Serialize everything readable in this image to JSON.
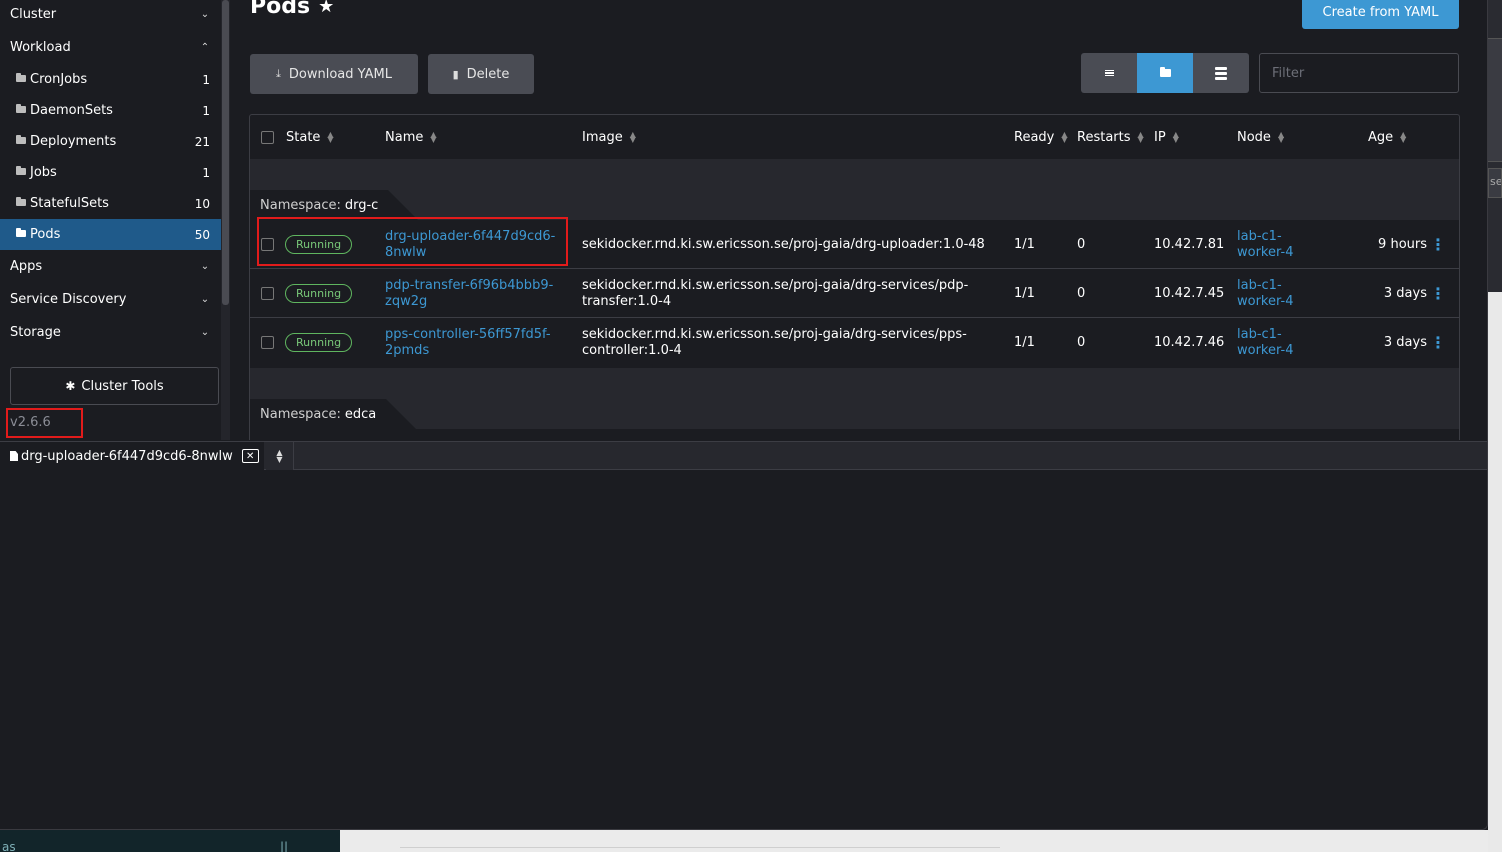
{
  "sidebar": {
    "groups": [
      {
        "label": "Cluster",
        "expanded": false
      },
      {
        "label": "Workload",
        "expanded": true
      },
      {
        "label": "Apps",
        "expanded": false
      },
      {
        "label": "Service Discovery",
        "expanded": false
      },
      {
        "label": "Storage",
        "expanded": false
      }
    ],
    "items": [
      {
        "label": "CronJobs",
        "count": "1"
      },
      {
        "label": "DaemonSets",
        "count": "1"
      },
      {
        "label": "Deployments",
        "count": "21"
      },
      {
        "label": "Jobs",
        "count": "1"
      },
      {
        "label": "StatefulSets",
        "count": "10"
      },
      {
        "label": "Pods",
        "count": "50",
        "active": true
      }
    ],
    "cluster_tools": "Cluster Tools",
    "version": "v2.6.6"
  },
  "page": {
    "title": "Pods",
    "create_button": "Create from YAML",
    "download_button": "Download YAML",
    "delete_button": "Delete",
    "filter_placeholder": "Filter"
  },
  "table": {
    "columns": {
      "state": "State",
      "name": "Name",
      "image": "Image",
      "ready": "Ready",
      "restarts": "Restarts",
      "ip": "IP",
      "node": "Node",
      "age": "Age"
    },
    "namespace_label": "Namespace:",
    "namespaces": [
      "drg-c",
      "edca"
    ],
    "rows": [
      {
        "state": "Running",
        "name": "drg-uploader-6f447d9cd6-8nwlw",
        "image": "sekidocker.rnd.ki.sw.ericsson.se/proj-gaia/drg-uploader:1.0-48",
        "ready": "1/1",
        "restarts": "0",
        "ip": "10.42.7.81",
        "node": "lab-c1-worker-4",
        "age": "9 hours"
      },
      {
        "state": "Running",
        "name": "pdp-transfer-6f96b4bbb9-zqw2g",
        "image": "sekidocker.rnd.ki.sw.ericsson.se/proj-gaia/drg-services/pdp-transfer:1.0-4",
        "ready": "1/1",
        "restarts": "0",
        "ip": "10.42.7.45",
        "node": "lab-c1-worker-4",
        "age": "3 days"
      },
      {
        "state": "Running",
        "name": "pps-controller-56ff57fd5f-2pmds",
        "image": "sekidocker.rnd.ki.sw.ericsson.se/proj-gaia/drg-services/pps-controller:1.0-4",
        "ready": "1/1",
        "restarts": "0",
        "ip": "10.42.7.46",
        "node": "lab-c1-worker-4",
        "age": "3 days"
      }
    ]
  },
  "dock": {
    "tab_label": "drg-uploader-6f447d9cd6-8nwlw"
  },
  "backdrop": {
    "left_text": "as",
    "left_mark": "||",
    "right_edge_text": "se"
  },
  "colors": {
    "accent": "#3d98d3",
    "active_nav": "#1f5a8a",
    "running": "#78c778",
    "highlight": "#e21b1b"
  }
}
